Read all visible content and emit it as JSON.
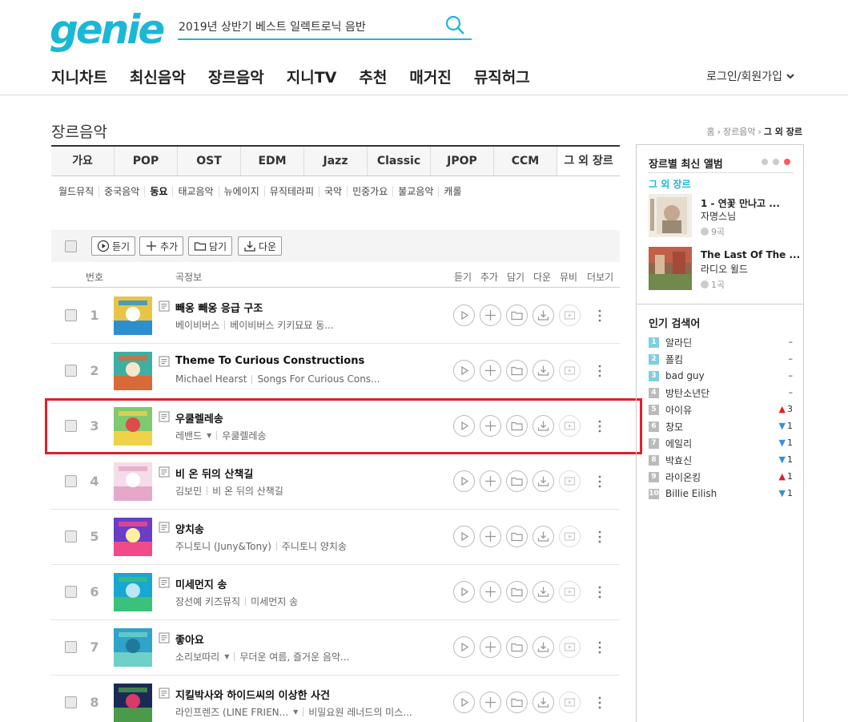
{
  "header": {
    "logo": "genie",
    "search_value": "2019년 상반기 베스트 일렉트로닉 음반",
    "nav": [
      "지니차트",
      "최신음악",
      "장르음악",
      "지니TV",
      "추천",
      "매거진",
      "뮤직허그"
    ],
    "login": "로그인/회원가입"
  },
  "page": {
    "title": "장르음악",
    "breadcrumb": [
      "홈",
      "장르음악",
      "그 외 장르"
    ]
  },
  "tabs": [
    "가요",
    "POP",
    "OST",
    "EDM",
    "Jazz",
    "Classic",
    "JPOP",
    "CCM",
    "그 외 장르"
  ],
  "subgenres": [
    "월드뮤직",
    "중국음악",
    "동요",
    "태교음악",
    "뉴에이지",
    "뮤직테라피",
    "국악",
    "민중가요",
    "불교음악",
    "캐롤"
  ],
  "toolbar": {
    "listen": "듣기",
    "add": "추가",
    "save": "담기",
    "download": "다운"
  },
  "columns": {
    "no": "번호",
    "info": "곡정보",
    "listen": "듣기",
    "add": "추가",
    "save": "담기",
    "download": "다운",
    "mv": "뮤비",
    "more": "더보기"
  },
  "songs": [
    {
      "rank": "1",
      "title": "빼옹 빼옹 응급 구조",
      "artist": "베이비버스",
      "album": "베이비버스 키키묘묘 동...",
      "dropdown": false
    },
    {
      "rank": "2",
      "title": "Theme To Curious Constructions",
      "artist": "Michael Hearst",
      "album": "Songs For Curious Cons...",
      "dropdown": false
    },
    {
      "rank": "3",
      "title": "우쿨렐레송",
      "artist": "레밴드",
      "album": "우쿨렐레송",
      "dropdown": true
    },
    {
      "rank": "4",
      "title": "비 온 뒤의 산책길",
      "artist": "김보민",
      "album": "비 온 뒤의 산책길",
      "dropdown": false
    },
    {
      "rank": "5",
      "title": "양치송",
      "artist": "주니토니 (Juny&Tony)",
      "album": "주니토니 양치송",
      "dropdown": false
    },
    {
      "rank": "6",
      "title": "미세먼지 송",
      "artist": "장선예 키즈뮤직",
      "album": "미세먼지 송",
      "dropdown": false
    },
    {
      "rank": "7",
      "title": "좋아요",
      "artist": "소리보따리",
      "album": "무더운 여름, 즐거운 음악...",
      "dropdown": true
    },
    {
      "rank": "8",
      "title": "지킬박사와 하이드씨의 이상한 사건",
      "artist": "라인프렌즈 (LINE FRIEN...",
      "album": "비밀요원 레너드의 미스...",
      "dropdown": true
    }
  ],
  "right_panel": {
    "title": "장르별 최신 앨범",
    "genre": "그 외 장르",
    "albums": [
      {
        "title": "1 - 연꽃 만나고 ...",
        "artist": "자명스님",
        "count": "9곡"
      },
      {
        "title": "The Last Of The ...",
        "artist": "라디오 윌드",
        "count": "1곡"
      }
    ],
    "popular_title": "인기 검색어",
    "popular": [
      {
        "num": "1",
        "term": "알라딘",
        "change": "–",
        "dir": "none"
      },
      {
        "num": "2",
        "term": "폴킴",
        "change": "–",
        "dir": "none"
      },
      {
        "num": "3",
        "term": "bad guy",
        "change": "–",
        "dir": "none"
      },
      {
        "num": "4",
        "term": "방탄소년단",
        "change": "–",
        "dir": "none"
      },
      {
        "num": "5",
        "term": "아이유",
        "change": "3",
        "dir": "up"
      },
      {
        "num": "6",
        "term": "창모",
        "change": "1",
        "dir": "down"
      },
      {
        "num": "7",
        "term": "에일리",
        "change": "1",
        "dir": "down"
      },
      {
        "num": "8",
        "term": "박효신",
        "change": "1",
        "dir": "down"
      },
      {
        "num": "9",
        "term": "라이온킹",
        "change": "1",
        "dir": "up"
      },
      {
        "num": "10",
        "term": "Billie Eilish",
        "change": "1",
        "dir": "down"
      }
    ]
  },
  "colors": {
    "brand": "#1ab8d4",
    "highlight": "#e0202a",
    "up": "#e0202a",
    "down": "#3a8fd9"
  }
}
